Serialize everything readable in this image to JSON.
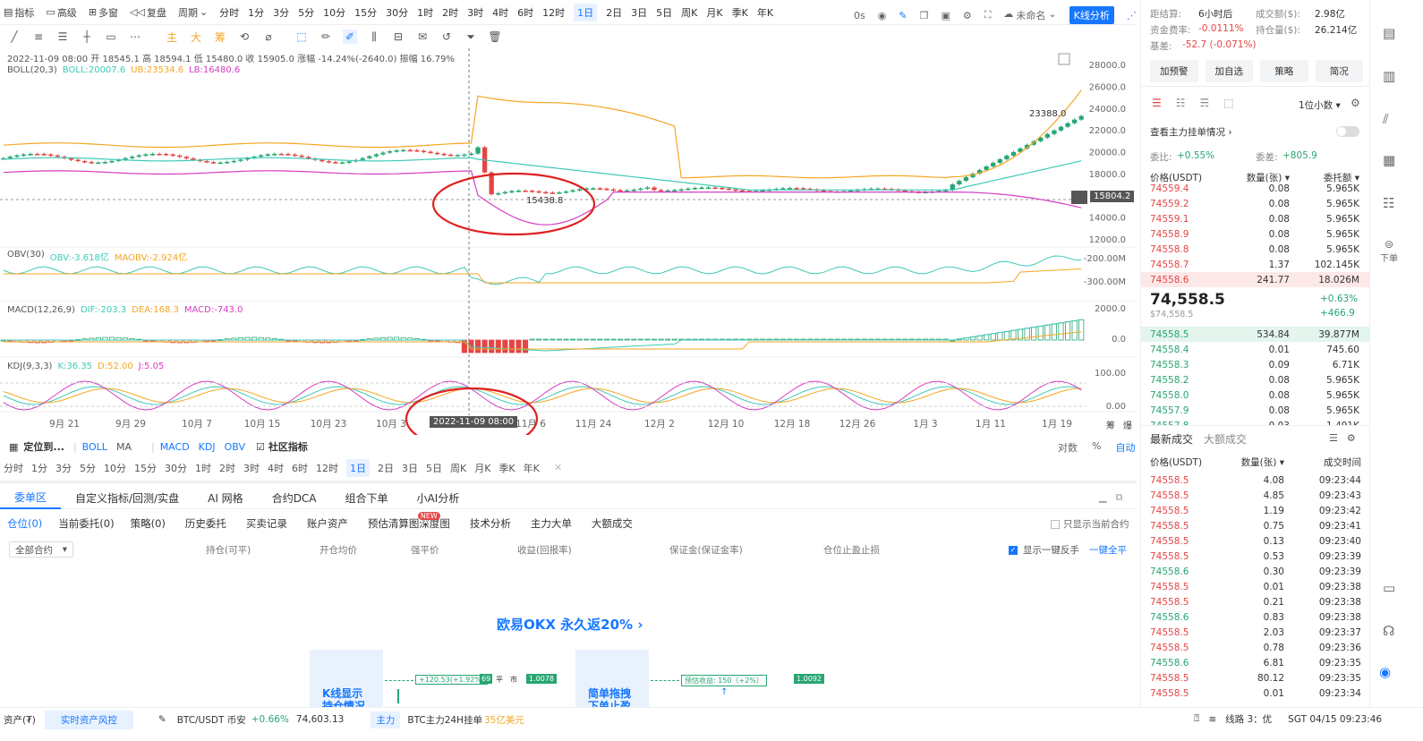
{
  "toolbar1": {
    "items": [
      "指标",
      "高级",
      "多窗",
      "复盘",
      "周期"
    ],
    "periods": [
      "分时",
      "1分",
      "3分",
      "5分",
      "10分",
      "15分",
      "30分",
      "1时",
      "2时",
      "3时",
      "4时",
      "6时",
      "12时",
      "1日",
      "2日",
      "3日",
      "5日",
      "周K",
      "月K",
      "季K",
      "年K"
    ],
    "selected_period": "1日",
    "countdown": "0s",
    "unnamed": "未命名",
    "kline_btn": "K线分析"
  },
  "chart": {
    "ohlc_line": "2022-11-09 08:00 开 18545.1 高 18594.1 低 15480.0 收 15905.0 涨幅 -14.24%(-2640.0) 振幅 16.79%",
    "boll_label": "BOLL(20,3)",
    "boll_mid": "BOLL:20007.6",
    "boll_up": "UB:23534.6",
    "boll_low": "LB:16480.6",
    "y_price": [
      "28000.0",
      "26000.0",
      "24000.0",
      "22000.0",
      "20000.0",
      "18000.0",
      "16000.0",
      "14000.0",
      "12000.0"
    ],
    "price_tag": "15804.2",
    "max_label": "23388.0",
    "min_label": "15438.8",
    "obv_label": "OBV(30)",
    "obv_val": "OBV:-3.618亿",
    "maobv_val": "MAOBV:-2.924亿",
    "y_obv": [
      "-200.00M",
      "-300.00M"
    ],
    "macd_label": "MACD(12,26,9)",
    "dif": "DIF:-203.3",
    "dea": "DEA:168.3",
    "macd": "MACD:-743.0",
    "y_macd": [
      "2000.0",
      "0.0"
    ],
    "kdj_label": "KDJ(9,3,3)",
    "k": "K:36.35",
    "d": "D:52.00",
    "j": "J:5.05",
    "y_kdj": [
      "100.00",
      "0.00"
    ],
    "x_dates": [
      "9月 21",
      "9月 29",
      "10月 7",
      "10月 15",
      "10月 23",
      "10月 3",
      "11月 6",
      "11月 24",
      "12月 2",
      "12月 10",
      "12月 18",
      "12月 26",
      "1月 3",
      "1月 11",
      "1月 19"
    ],
    "crosshair_date": "2022-11-09 08:00",
    "corner_labels": [
      "筹",
      "爆"
    ]
  },
  "indbar": {
    "locate": "定位到...",
    "items": [
      "BOLL",
      "MA",
      "MACD",
      "KDJ",
      "OBV"
    ],
    "community": "社区指标",
    "right": [
      "对数",
      "%",
      "自动"
    ]
  },
  "periodbar": {
    "periods": [
      "分时",
      "1分",
      "3分",
      "5分",
      "10分",
      "15分",
      "30分",
      "1时",
      "2时",
      "3时",
      "4时",
      "6时",
      "12时",
      "1日",
      "2日",
      "3日",
      "5日",
      "周K",
      "月K",
      "季K",
      "年K"
    ],
    "selected": "1日"
  },
  "orderpanel": {
    "tabs": [
      "委单区",
      "自定义指标/回测/实盘",
      "AI 网格",
      "合约DCA",
      "组合下单",
      "小AI分析"
    ],
    "subtabs": [
      "仓位(0)",
      "当前委托(0)",
      "策略(0)",
      "历史委托",
      "买卖记录",
      "账户资产",
      "预估清算图",
      "深度图",
      "技术分析",
      "主力大单",
      "大额成交"
    ],
    "new_badge": "NEW",
    "only_current": "只显示当前合约",
    "filter": "全部合约",
    "columns": [
      "持仓(可平)",
      "开仓均价",
      "强平价",
      "收益(回报率)",
      "保证金(保证金率)",
      "仓位止盈止损"
    ],
    "reverse": "显示一键反手",
    "close_all": "一键全平",
    "promo": "欧易OKX 永久返20%",
    "card1_title": "K线显示",
    "card1_title2": "持仓情况",
    "card1_tag": "+120.53(+1.92%)",
    "card1_num": "69",
    "card1_flat": "平",
    "card1_mkt": "市",
    "card1_price": "1.0078",
    "card2_title": "简单拖拽",
    "card2_title2": "下单止盈",
    "card2_tag": "预估收益: 150（+2%）",
    "card2_price": "1.0092"
  },
  "right": {
    "dist_label": "距结算:",
    "dist_val": "6小时后",
    "vol_label": "成交额($):",
    "vol_val": "2.98亿",
    "fund_label": "资金费率:",
    "fund_val": "-0.0111%",
    "hold_label": "持仓量($):",
    "hold_val": "26.214亿",
    "basis_label": "基差:",
    "basis_val": "-52.7 (-0.071%)",
    "buttons": [
      "加预警",
      "加自选",
      "策略",
      "简况"
    ],
    "decimal": "1位小数",
    "main_force": "查看主力挂单情况",
    "ratio_label": "委比:",
    "ratio_val": "+0.55%",
    "diff_label": "委差:",
    "diff_val": "+805.9",
    "ob_headers": [
      "价格(USDT)",
      "数量(张)",
      "委托额"
    ],
    "asks": [
      {
        "p": "74559.4",
        "q": "0.08",
        "t": "5.965K"
      },
      {
        "p": "74559.2",
        "q": "0.08",
        "t": "5.965K"
      },
      {
        "p": "74559.1",
        "q": "0.08",
        "t": "5.965K"
      },
      {
        "p": "74558.9",
        "q": "0.08",
        "t": "5.965K"
      },
      {
        "p": "74558.8",
        "q": "0.08",
        "t": "5.965K"
      },
      {
        "p": "74558.7",
        "q": "1.37",
        "t": "102.145K"
      },
      {
        "p": "74558.6",
        "q": "241.77",
        "t": "18.026M"
      }
    ],
    "last_price": "74,558.5",
    "last_change": "+0.63%",
    "last_sub": "$74,558.5",
    "last_abs": "+466.9",
    "bids": [
      {
        "p": "74558.5",
        "q": "534.84",
        "t": "39.877M"
      },
      {
        "p": "74558.4",
        "q": "0.01",
        "t": "745.60"
      },
      {
        "p": "74558.3",
        "q": "0.09",
        "t": "6.71K"
      },
      {
        "p": "74558.2",
        "q": "0.08",
        "t": "5.965K"
      },
      {
        "p": "74558.0",
        "q": "0.08",
        "t": "5.965K"
      },
      {
        "p": "74557.9",
        "q": "0.08",
        "t": "5.965K"
      },
      {
        "p": "74557.8",
        "q": "0.03",
        "t": "1.491K"
      }
    ],
    "trade_tabs": [
      "最新成交",
      "大额成交"
    ],
    "tr_headers": [
      "价格(USDT)",
      "数量(张)",
      "成交时间"
    ],
    "trades": [
      {
        "p": "74558.5",
        "q": "4.08",
        "t": "09:23:44",
        "c": "red"
      },
      {
        "p": "74558.5",
        "q": "4.85",
        "t": "09:23:43",
        "c": "red"
      },
      {
        "p": "74558.5",
        "q": "1.19",
        "t": "09:23:42",
        "c": "red"
      },
      {
        "p": "74558.5",
        "q": "0.75",
        "t": "09:23:41",
        "c": "red"
      },
      {
        "p": "74558.5",
        "q": "0.13",
        "t": "09:23:40",
        "c": "red"
      },
      {
        "p": "74558.5",
        "q": "0.53",
        "t": "09:23:39",
        "c": "red"
      },
      {
        "p": "74558.6",
        "q": "0.30",
        "t": "09:23:39",
        "c": "green"
      },
      {
        "p": "74558.5",
        "q": "0.01",
        "t": "09:23:38",
        "c": "red"
      },
      {
        "p": "74558.5",
        "q": "0.21",
        "t": "09:23:38",
        "c": "red"
      },
      {
        "p": "74558.6",
        "q": "0.83",
        "t": "09:23:38",
        "c": "green"
      },
      {
        "p": "74558.5",
        "q": "2.03",
        "t": "09:23:37",
        "c": "red"
      },
      {
        "p": "74558.5",
        "q": "0.78",
        "t": "09:23:36",
        "c": "red"
      },
      {
        "p": "74558.6",
        "q": "6.81",
        "t": "09:23:35",
        "c": "green"
      },
      {
        "p": "74558.5",
        "q": "80.12",
        "t": "09:23:35",
        "c": "red"
      },
      {
        "p": "74558.5",
        "q": "0.01",
        "t": "09:23:34",
        "c": "red"
      }
    ]
  },
  "sidebar": {
    "order_label": "下单"
  },
  "bottom": {
    "assets": "资产(₮)",
    "risk": "实时资产风控",
    "pair": "BTC/USDT 币安",
    "pair_change": "+0.66%",
    "pair_price": "74,603.13",
    "main_tag": "主力",
    "main_text": "BTC主力24H挂单",
    "main_val": "35亿美元",
    "line": "线路 3：优",
    "time": "SGT 04/15 09:23:46"
  },
  "colors": {
    "accent": "#1677ff",
    "up": "#27a672",
    "down": "#e54545",
    "boll_up": "#f5a623",
    "boll_low": "#d63cc3",
    "boll_mid": "#3ec9b5"
  }
}
